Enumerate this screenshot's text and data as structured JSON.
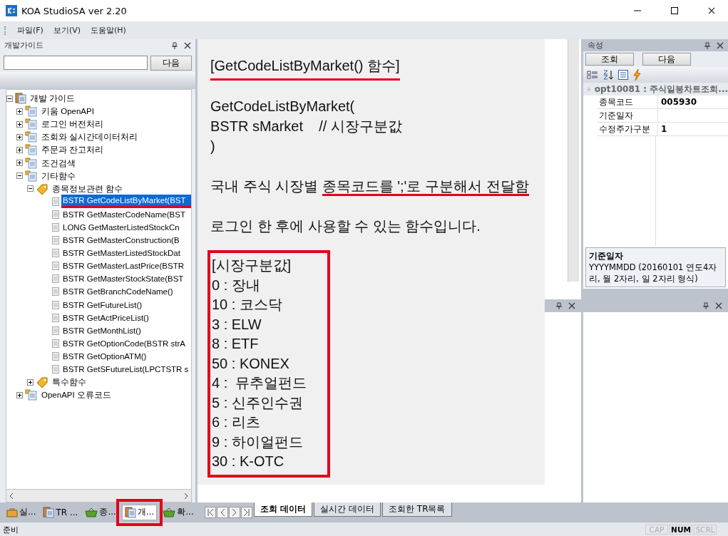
{
  "window": {
    "title": "KOA StudioSA ver 2.20"
  },
  "menu": [
    {
      "label": "파일(F)"
    },
    {
      "label": "보기(V)"
    },
    {
      "label": "도움말(H)"
    }
  ],
  "guide_panel": {
    "title": "개발가이드",
    "search_button": "다음",
    "tree": [
      {
        "label": "개발 가이드",
        "kind": "book",
        "expanded": true,
        "selected": false,
        "children": [
          {
            "label": "키움 OpenAPI",
            "kind": "folder",
            "expanded": false,
            "selected": false
          },
          {
            "label": "로그인 버전처리",
            "kind": "folder",
            "expanded": false,
            "selected": false
          },
          {
            "label": "조회와 실시간데이터처리",
            "kind": "folder",
            "expanded": false,
            "selected": false
          },
          {
            "label": "주문과 잔고처리",
            "kind": "folder",
            "expanded": false,
            "selected": false
          },
          {
            "label": "조건검색",
            "kind": "folder",
            "expanded": false,
            "selected": false
          },
          {
            "label": "기타함수",
            "kind": "folder",
            "expanded": true,
            "selected": false,
            "children": [
              {
                "label": "종목정보관련 함수",
                "kind": "tag",
                "expanded": true,
                "selected": false,
                "children": [
                  {
                    "label": "BSTR GetCodeListByMarket(BST",
                    "kind": "page",
                    "selected": true
                  },
                  {
                    "label": "BSTR GetMasterCodeName(BST",
                    "kind": "page",
                    "selected": false
                  },
                  {
                    "label": "LONG GetMasterListedStockCn",
                    "kind": "page",
                    "selected": false
                  },
                  {
                    "label": "BSTR GetMasterConstruction(B",
                    "kind": "page",
                    "selected": false
                  },
                  {
                    "label": "BSTR GetMasterListedStockDat",
                    "kind": "page",
                    "selected": false
                  },
                  {
                    "label": "BSTR GetMasterLastPrice(BSTR",
                    "kind": "page",
                    "selected": false
                  },
                  {
                    "label": "BSTR GetMasterStockState(BST",
                    "kind": "page",
                    "selected": false
                  },
                  {
                    "label": "BSTR GetBranchCodeName()",
                    "kind": "page",
                    "selected": false
                  },
                  {
                    "label": "BSTR GetFutureList()",
                    "kind": "page",
                    "selected": false
                  },
                  {
                    "label": "BSTR GetActPriceList()",
                    "kind": "page",
                    "selected": false
                  },
                  {
                    "label": "BSTR GetMonthList()",
                    "kind": "page",
                    "selected": false
                  },
                  {
                    "label": "BSTR GetOptionCode(BSTR strA",
                    "kind": "page",
                    "selected": false
                  },
                  {
                    "label": "BSTR GetOptionATM()",
                    "kind": "page",
                    "selected": false
                  },
                  {
                    "label": "BSTR GetSFutureList(LPCTSTR s",
                    "kind": "page",
                    "selected": false
                  }
                ]
              },
              {
                "label": "특수함수",
                "kind": "tag",
                "expanded": false,
                "selected": false
              }
            ]
          },
          {
            "label": "OpenAPI 오류코드",
            "kind": "folder",
            "expanded": false,
            "selected": false
          }
        ]
      }
    ],
    "tabs": [
      {
        "label": "실...",
        "kind": "bag",
        "selected": false
      },
      {
        "label": "TR ...",
        "kind": "book",
        "selected": false
      },
      {
        "label": "종...",
        "kind": "basket",
        "selected": false
      },
      {
        "label": "개...",
        "kind": "book",
        "selected": true
      },
      {
        "label": "확...",
        "kind": "basket",
        "selected": false
      }
    ]
  },
  "document": {
    "title": "[GetCodeListByMarket() 함수]",
    "code": [
      "GetCodeListByMarket(",
      "BSTR sMarket    // 시장구분값",
      ")"
    ],
    "description_plain": "국내 주식 시장별 ",
    "description_marked": "종목코드를 ';'로 구분해서 전달함",
    "note": "로그인 한 후에 사용할 수 있는 함수입니다.",
    "list_title": "[시장구분값]",
    "items": [
      "0 : 장내",
      "10 : 코스닥",
      "3 : ELW",
      "8 : ETF",
      "50 : KONEX",
      "4 :  뮤추얼펀드",
      "5 : 신주인수권",
      "6 : 리츠",
      "9 : 하이얼펀드",
      "30 : K-OTC"
    ]
  },
  "bottom_tabs": [
    {
      "label": "조회 데이터",
      "selected": true
    },
    {
      "label": "실시간 데이터",
      "selected": false
    },
    {
      "label": "조회한 TR목록",
      "selected": false
    }
  ],
  "properties_panel": {
    "title": "속성",
    "buttons": [
      "조회",
      "다음"
    ],
    "category": {
      "label": "opt10081 : 주식일봉차트조회...",
      "expanded": true
    },
    "rows": [
      {
        "name": "종목코드",
        "value": "005930"
      },
      {
        "name": "기준일자"
      },
      {
        "name": "수정주가구분",
        "value": "1"
      }
    ],
    "help_title": "기준일자",
    "help_text": "YYYYMMDD (20160101 연도4자리, 월 2자리, 일 2자리 형식)"
  },
  "status_bar": {
    "text": "준비",
    "indicators": [
      {
        "label": "CAP",
        "on": false
      },
      {
        "label": "NUM",
        "on": true
      },
      {
        "label": "SCRL",
        "on": false
      }
    ]
  }
}
